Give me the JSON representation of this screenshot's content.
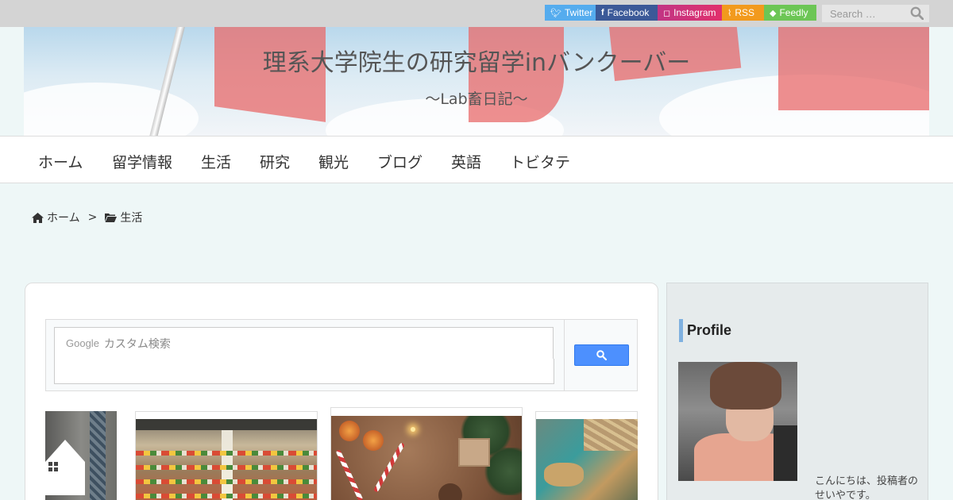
{
  "topbar": {
    "social": [
      {
        "label": "Twitter",
        "icon": "twitter-icon"
      },
      {
        "label": "Facebook",
        "icon": "facebook-icon"
      },
      {
        "label": "Instagram",
        "icon": "instagram-icon"
      },
      {
        "label": "RSS",
        "icon": "rss-icon"
      },
      {
        "label": "Feedly",
        "icon": "feedly-icon"
      }
    ],
    "search_placeholder": "Search …"
  },
  "header": {
    "title": "理系大学院生の研究留学inバンクーバー",
    "subtitle": "～Lab畜日記～"
  },
  "nav": {
    "items": [
      "ホーム",
      "留学情報",
      "生活",
      "研究",
      "観光",
      "ブログ",
      "英語",
      "トビタテ"
    ]
  },
  "breadcrumb": {
    "home": "ホーム",
    "separator": ">",
    "current": "生活"
  },
  "search": {
    "placeholder_prefix": "Google",
    "placeholder": "カスタム検索"
  },
  "sidebar": {
    "profile_heading": "Profile",
    "bio": "こんにちは、投稿者のせいやです。"
  },
  "colors": {
    "twitter": "#55acee",
    "facebook": "#3b5998",
    "instagram": "#c13584",
    "rss": "#f29a1d",
    "feedly": "#6cc655",
    "search_button": "#4d90fe",
    "accent": "#7fb1e0"
  }
}
